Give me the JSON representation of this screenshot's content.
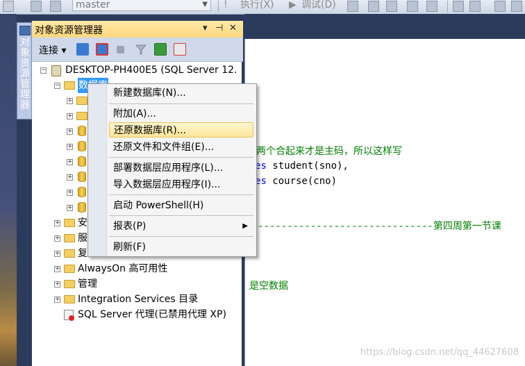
{
  "toolbar": {
    "database": "master",
    "execute": "执行(X)",
    "debug": "调试(D)"
  },
  "vertical_tab": {
    "label": "对象资源管理器"
  },
  "explorer": {
    "title": "对象资源管理器",
    "pin_glyph": "▾ ⊣ ✕",
    "connect_label": "连接",
    "tree": {
      "server": "DESKTOP-PH400E5 (SQL Server 12.",
      "databases_label": "数据库",
      "security_label": "安",
      "server_objects_label": "服",
      "replication_label": "复",
      "alwayson_label": "AlwaysOn 高可用性",
      "management_label": "管理",
      "integration_label": "Integration Services 目录",
      "agent_label": "SQL Server 代理(已禁用代理 XP)"
    }
  },
  "context_menu": {
    "items": [
      {
        "label": "新建数据库(N)..."
      },
      {
        "label": "附加(A)..."
      },
      {
        "label": "还原数据库(R)...",
        "highlighted": true
      },
      {
        "label": "还原文件和文件组(E)..."
      },
      {
        "label": "部署数据层应用程序(L)..."
      },
      {
        "label": "导入数据层应用程序(I)..."
      },
      {
        "label": "启动 PowerShell(H)"
      },
      {
        "label": "报表(P)",
        "submenu": true
      },
      {
        "label": "刷新(F)"
      }
    ]
  },
  "editor": {
    "line1": "两个合起来才是主码，所以这样写",
    "line2_kw": "es",
    "line2_rest": " student(sno),",
    "line3_kw": "es",
    "line3_rest": " course(cno)",
    "line4": "------------------------------第四周第一节课",
    "line5": "是空数据"
  },
  "watermark": "https://blog.csdn.net/qq_44627608"
}
